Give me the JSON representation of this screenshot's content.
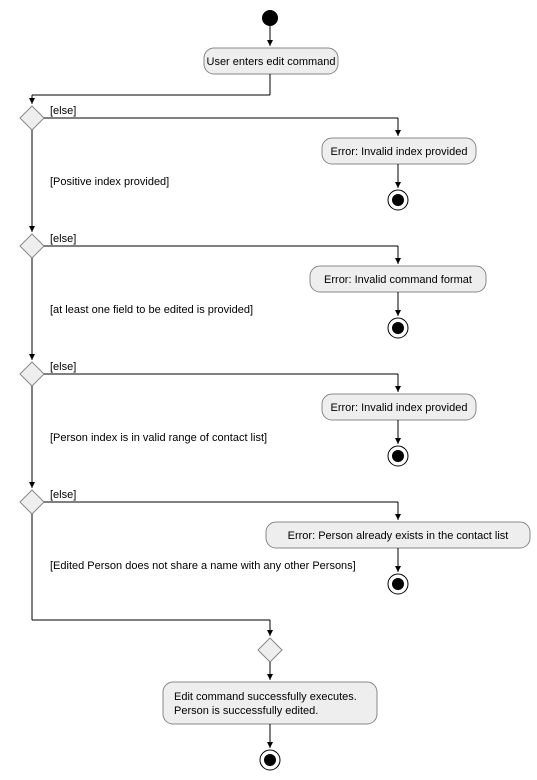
{
  "nodes": {
    "start_activity": "User enters edit command",
    "d1_else": "[else]",
    "d1_error": "Error: Invalid index provided",
    "d1_guard": "[Positive index provided]",
    "d2_else": "[else]",
    "d2_error": "Error: Invalid command format",
    "d2_guard": "[at least one field to be edited is provided]",
    "d3_else": "[else]",
    "d3_error": "Error: Invalid index provided",
    "d3_guard": "[Person index is in valid range of contact list]",
    "d4_else": "[else]",
    "d4_error": "Error: Person already exists in the contact list",
    "d4_guard": "[Edited Person does not share a name with any other Persons]",
    "success_line1": "Edit command successfully executes.",
    "success_line2": "Person is successfully edited."
  }
}
